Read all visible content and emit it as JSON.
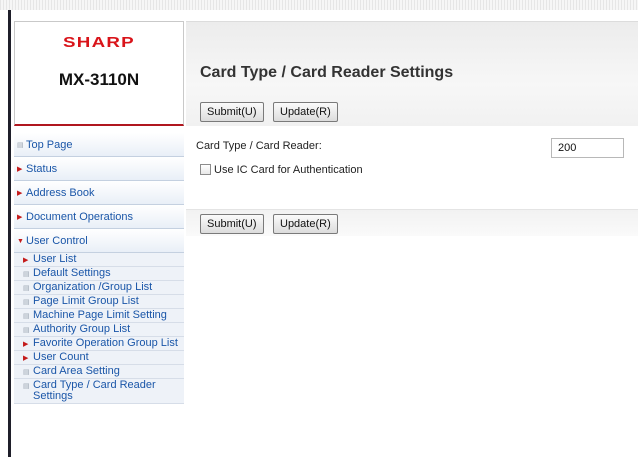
{
  "brand": {
    "logo": "SHARP",
    "model": "MX-3110N"
  },
  "header": {
    "title": "Card Type / Card Reader Settings"
  },
  "buttons": {
    "submit": "Submit(U)",
    "update": "Update(R)"
  },
  "form": {
    "card_type_label": "Card Type / Card Reader:",
    "card_type_value": "200",
    "ic_card_label": "Use IC Card for Authentication",
    "ic_card_checked": false
  },
  "sidebar": {
    "items": [
      {
        "label": "Top Page",
        "icon": "page-icon"
      },
      {
        "label": "Status",
        "icon": "arrow-right-icon"
      },
      {
        "label": "Address Book",
        "icon": "arrow-right-icon"
      },
      {
        "label": "Document Operations",
        "icon": "arrow-right-icon"
      },
      {
        "label": "User Control",
        "icon": "arrow-down-icon"
      }
    ],
    "sub_items": [
      {
        "label": "User List",
        "icon": "arrow-right-icon"
      },
      {
        "label": "Default Settings",
        "icon": "page-icon"
      },
      {
        "label": "Organization /Group List",
        "icon": "page-icon"
      },
      {
        "label": "Page Limit Group List",
        "icon": "page-icon"
      },
      {
        "label": "Machine Page Limit Setting",
        "icon": "page-icon"
      },
      {
        "label": "Authority Group List",
        "icon": "page-icon"
      },
      {
        "label": "Favorite Operation Group List",
        "icon": "arrow-right-icon"
      },
      {
        "label": "User Count",
        "icon": "arrow-right-icon"
      },
      {
        "label": "Card Area Setting",
        "icon": "page-icon"
      },
      {
        "label": "Card Type / Card Reader Settings",
        "icon": "page-icon"
      }
    ]
  },
  "colors": {
    "brand_red": "#d9141a",
    "link_blue": "#1a56a8",
    "arrow_red": "#c41a1a"
  }
}
